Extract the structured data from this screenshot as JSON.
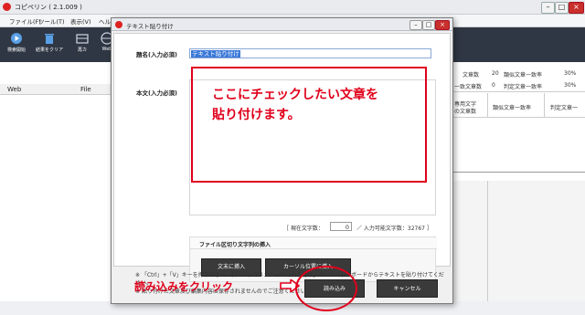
{
  "app": {
    "title": "コピペリン ( 2.1.009 )",
    "menu": [
      "ファイル(F)",
      "ツール(T)",
      "表示(V)",
      "ヘルプ"
    ],
    "toolbar": [
      {
        "label": "検索開始",
        "icon": "play-icon"
      },
      {
        "label": "結果をクリア",
        "icon": "trash-icon"
      },
      {
        "label": "再カ",
        "icon": "database-icon"
      },
      {
        "label": "Web",
        "icon": "globe-icon"
      }
    ],
    "list_headers": [
      "Web",
      "File"
    ],
    "right_table": {
      "row1": [
        "文章数",
        "20",
        "類似文章一致率",
        "30%"
      ],
      "row2": [
        "一致文章数",
        "0",
        "判定文章一致率",
        "30%"
      ],
      "hdr_col1": [
        "専用文字",
        "の文章数"
      ],
      "hdr_col2": "類似文章一致率",
      "hdr_col3": "判定文章一"
    }
  },
  "dialog": {
    "title": "テキスト貼り付け",
    "name_label": "題名(入力必須)",
    "name_value": "テキスト貼り付け",
    "body_label": "本文(入力必須)",
    "instruction_line1": "ここにチェックしたい文章を",
    "instruction_line2": "貼り付けます。",
    "current_count_label": "［ 現在文字数：",
    "current_count": "0",
    "max_count_label": "／ 入力可能文字数：32767 ］",
    "separator_title": "ファイル区切り文字列の挿入",
    "insert_end_button": "文末に挿入",
    "insert_cursor_button": "カーソル位置に挿入",
    "note1": "※ 「Ctrl」+「V」キーを押下するか、右クリックメニューの「貼り付け」で、クリップボードからテキストを貼り付けてください。",
    "note2": "※ 貼り付けた文章及び編集内容は保存されませんのでご注意ください。",
    "read_instruction": "読み込みをクリック",
    "ok_button": "読み込み",
    "cancel_button": "キャンセル"
  },
  "colors": {
    "toolbar_bg": "#2f3744",
    "annotation_red": "#e0001b",
    "selection_blue": "#3a78d8"
  }
}
